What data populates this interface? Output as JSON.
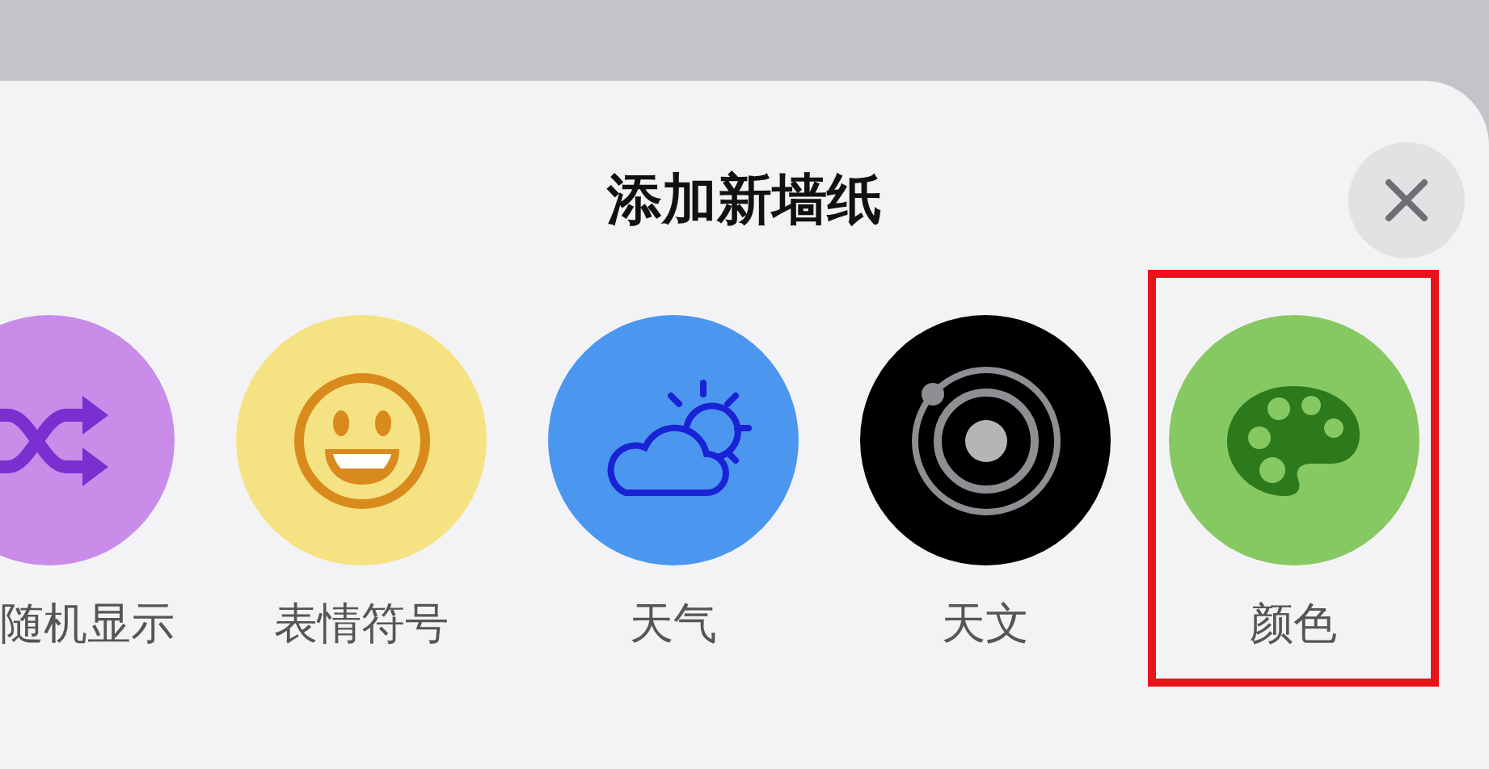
{
  "sheet": {
    "title": "添加新墙纸"
  },
  "items": [
    {
      "kind": "shuffle",
      "label": "随机显示",
      "highlighted": false
    },
    {
      "kind": "emoji",
      "label": "表情符号",
      "highlighted": false
    },
    {
      "kind": "weather",
      "label": "天气",
      "highlighted": false
    },
    {
      "kind": "astronomy",
      "label": "天文",
      "highlighted": false
    },
    {
      "kind": "color",
      "label": "颜色",
      "highlighted": true
    }
  ]
}
